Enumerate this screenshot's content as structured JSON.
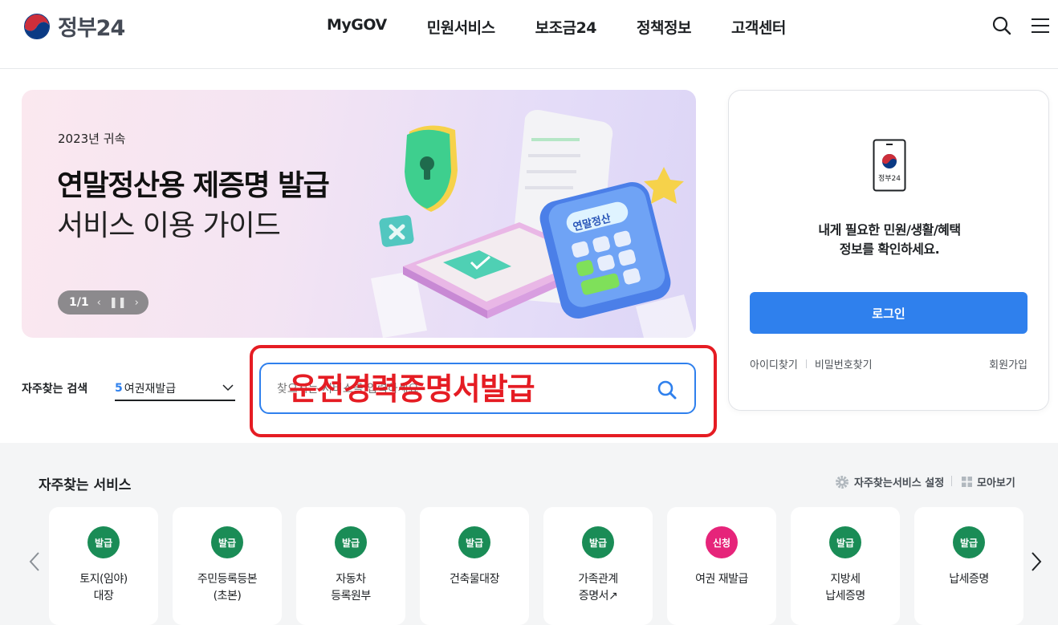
{
  "header": {
    "logo_text": "정부24",
    "nav": [
      "MyGOV",
      "민원서비스",
      "보조금24",
      "정책정보",
      "고객센터"
    ]
  },
  "banner": {
    "year": "2023년 귀속",
    "title": "연말정산용 제증명 발급",
    "subtitle": "서비스 이용 가이드",
    "page": "1/1",
    "art_label": "연말정산"
  },
  "login": {
    "phone_label": "정부24",
    "message_line1": "내게 필요한 민원/생활/혜택",
    "message_line2": "정보를 확인하세요.",
    "button": "로그인",
    "find_id": "아이디찾기",
    "find_pw": "비밀번호찾기",
    "signup": "회원가입"
  },
  "search": {
    "freq_label": "자주찾는 검색",
    "freq_rank": "5",
    "freq_value": "여권재발급",
    "placeholder": "찾으시는 서비스를 입력하세요",
    "annotation": "운전경력증명서발급",
    "annotation_color": "#e51c23"
  },
  "services": {
    "title": "자주찾는 서비스",
    "setting": "자주찾는서비스 설정",
    "view_all": "모아보기",
    "cards": [
      {
        "badge": "발급",
        "type": "issue",
        "label": "토지(임야)\n대장"
      },
      {
        "badge": "발급",
        "type": "issue",
        "label": "주민등록등본\n(초본)"
      },
      {
        "badge": "발급",
        "type": "issue",
        "label": "자동차\n등록원부"
      },
      {
        "badge": "발급",
        "type": "issue",
        "label": "건축물대장"
      },
      {
        "badge": "발급",
        "type": "issue",
        "label": "가족관계\n증명서↗"
      },
      {
        "badge": "신청",
        "type": "apply",
        "label": "여권 재발급"
      },
      {
        "badge": "발급",
        "type": "issue",
        "label": "지방세\n납세증명"
      },
      {
        "badge": "발급",
        "type": "issue",
        "label": "납세증명"
      }
    ]
  },
  "colors": {
    "primary": "#2f80ed",
    "issue_badge": "#1a8c56",
    "apply_badge": "#e6247a"
  }
}
